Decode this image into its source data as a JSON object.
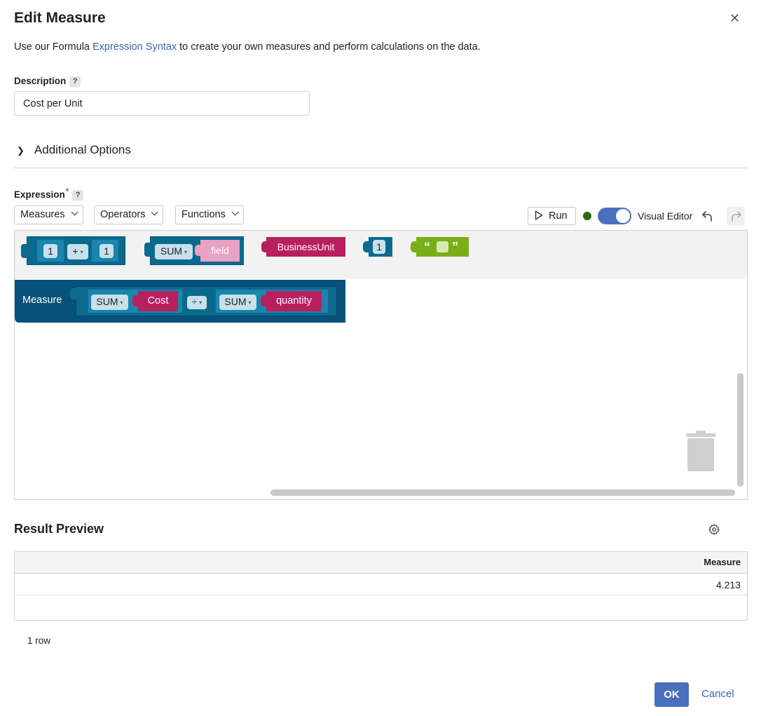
{
  "dialog": {
    "title": "Edit Measure",
    "intro_prefix": "Use our Formula ",
    "intro_link": "Expression Syntax",
    "intro_suffix": " to create your own measures and perform calculations on the data."
  },
  "description": {
    "label": "Description",
    "help": "?",
    "value": "Cost per Unit"
  },
  "additional_options": {
    "label": "Additional Options"
  },
  "expression": {
    "label": "Expression",
    "required_mark": "*",
    "help": "?",
    "dropdowns": [
      "Measures",
      "Operators",
      "Functions"
    ],
    "run_label": "Run",
    "visual_editor_label": "Visual Editor",
    "visual_editor_on": true,
    "status_color": "#2d6a0e"
  },
  "flyout_blocks": {
    "arith": {
      "left": "1",
      "op": "+",
      "right": "1"
    },
    "sum_field": {
      "func": "SUM",
      "field": "field"
    },
    "business_unit": "BusinessUnit",
    "number": "1",
    "text_open": "“",
    "text_close": "”"
  },
  "measure_block": {
    "label": "Measure",
    "left_func": "SUM",
    "left_field": "Cost",
    "operator": "÷",
    "right_func": "SUM",
    "right_field": "quantity"
  },
  "result_preview": {
    "title": "Result Preview",
    "columns": [
      "Measure"
    ],
    "rows": [
      [
        "4.213"
      ]
    ],
    "row_count": "1 row"
  },
  "footer": {
    "ok_label": "OK",
    "cancel_label": "Cancel"
  },
  "colors": {
    "accent": "#4a6fbd",
    "block_blue": "#0a6a8e",
    "block_magenta": "#b81f5f",
    "block_pink": "#e8a2c3",
    "block_green": "#79ae18",
    "measure_dark": "#06527a"
  },
  "icons": [
    "close-icon",
    "help-icon",
    "chevron-right-icon",
    "chevron-down-icon",
    "play-icon",
    "undo-icon",
    "redo-icon",
    "trash-icon",
    "gear-icon"
  ]
}
